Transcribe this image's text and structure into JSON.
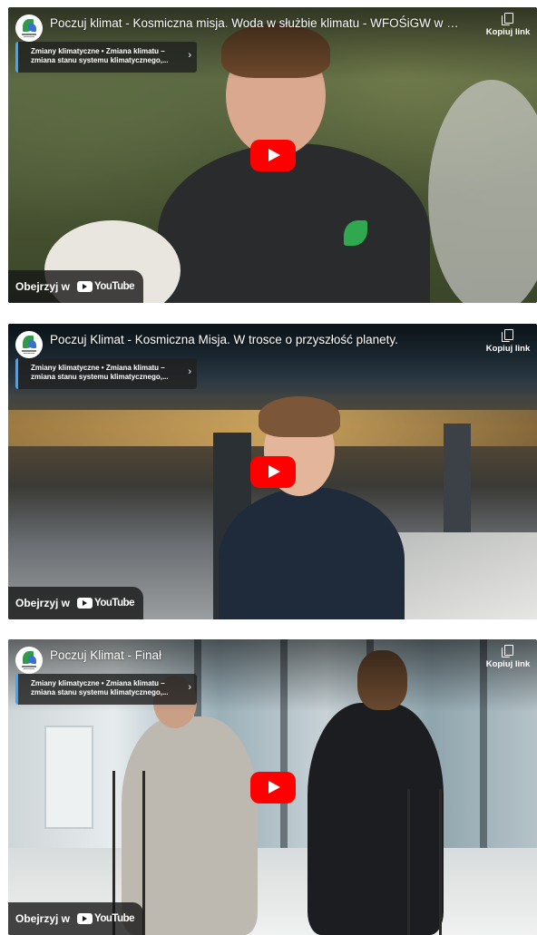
{
  "embeds": [
    {
      "title": "Poczuj klimat - Kosmiczna misja. Woda w służbie klimatu - WFOŚiGW w Opolu",
      "copy_link_label": "Kopiuj link",
      "playlist_line1": "Zmiany klimatyczne • Zmiana klimatu –",
      "playlist_line2": "zmiana stanu systemu klimatycznego,...",
      "watch_on_label": "Obejrzyj w",
      "youtube_wordmark": "YouTube"
    },
    {
      "title": "Poczuj Klimat - Kosmiczna Misja. W trosce o przyszłość planety.",
      "copy_link_label": "Kopiuj link",
      "playlist_line1": "Zmiany klimatyczne • Zmiana klimatu –",
      "playlist_line2": "zmiana stanu systemu klimatycznego,...",
      "watch_on_label": "Obejrzyj w",
      "youtube_wordmark": "YouTube"
    },
    {
      "title": "Poczuj Klimat - Finał",
      "copy_link_label": "Kopiuj link",
      "playlist_line1": "Zmiany klimatyczne • Zmiana klimatu –",
      "playlist_line2": "zmiana stanu systemu klimatycznego,...",
      "watch_on_label": "Obejrzyj w",
      "youtube_wordmark": "YouTube"
    }
  ],
  "colors": {
    "play_button": "#ff0000",
    "playlist_accent": "#3ea6ff",
    "overlay_bg": "#212121"
  },
  "icons": {
    "channel_avatar": "wfosigw-logo-icon",
    "copy": "copy-link-icon",
    "play": "play-icon",
    "youtube": "youtube-logo-icon",
    "chevron": "chevron-right-icon"
  }
}
